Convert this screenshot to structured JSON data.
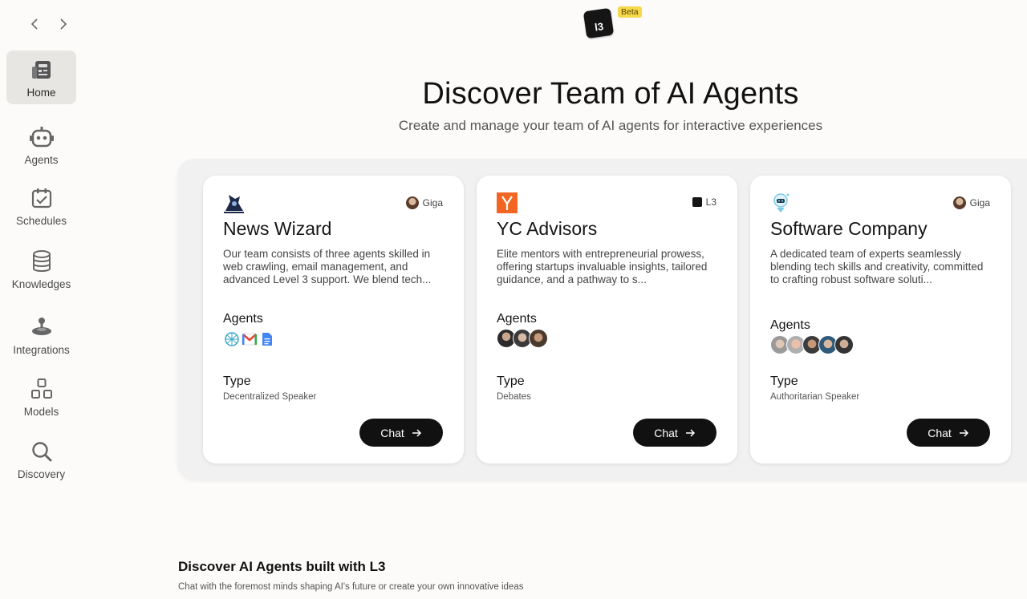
{
  "sidebar": {
    "items": [
      {
        "label": "Home",
        "icon": "home-newspaper-icon",
        "active": true
      },
      {
        "label": "Agents",
        "icon": "robot-icon"
      },
      {
        "label": "Schedules",
        "icon": "calendar-check-icon"
      },
      {
        "label": "Knowledges",
        "icon": "database-icon"
      },
      {
        "label": "Integrations",
        "icon": "joystick-icon"
      },
      {
        "label": "Models",
        "icon": "grid-blocks-icon"
      },
      {
        "label": "Discovery",
        "icon": "search-icon"
      }
    ]
  },
  "header": {
    "logo_text": "l3",
    "badge": "Beta",
    "title": "Discover Team of AI Agents",
    "subtitle": "Create and manage your team of AI agents for interactive experiences"
  },
  "cards": [
    {
      "name": "News Wizard",
      "owner": "Giga",
      "description": "Our team consists of three agents skilled in web crawling, email management, and advanced Level 3 support. We blend tech...",
      "agents_label": "Agents",
      "type_label": "Type",
      "type_value": "Decentralized Speaker",
      "chat_label": "Chat"
    },
    {
      "name": "YC Advisors",
      "owner": "L3",
      "description": "Elite mentors with entrepreneurial prowess, offering startups invaluable insights, tailored guidance, and a pathway to s...",
      "agents_label": "Agents",
      "type_label": "Type",
      "type_value": "Debates",
      "chat_label": "Chat"
    },
    {
      "name": "Software Company",
      "owner": "Giga",
      "description": "A dedicated team of experts seamlessly blending tech skills and creativity, committed to crafting robust software soluti...",
      "agents_label": "Agents",
      "type_label": "Type",
      "type_value": "Authoritarian Speaker",
      "chat_label": "Chat"
    }
  ],
  "discover": {
    "title": "Discover AI Agents built with L3",
    "subtitle": "Chat with the foremost minds shaping AI's future or create your own innovative ideas"
  },
  "colors": {
    "background": "#fcfbfa",
    "active_nav": "#e8e6e3",
    "button": "#111111",
    "beta_badge": "#f6d84a",
    "yc_orange": "#f26522"
  }
}
